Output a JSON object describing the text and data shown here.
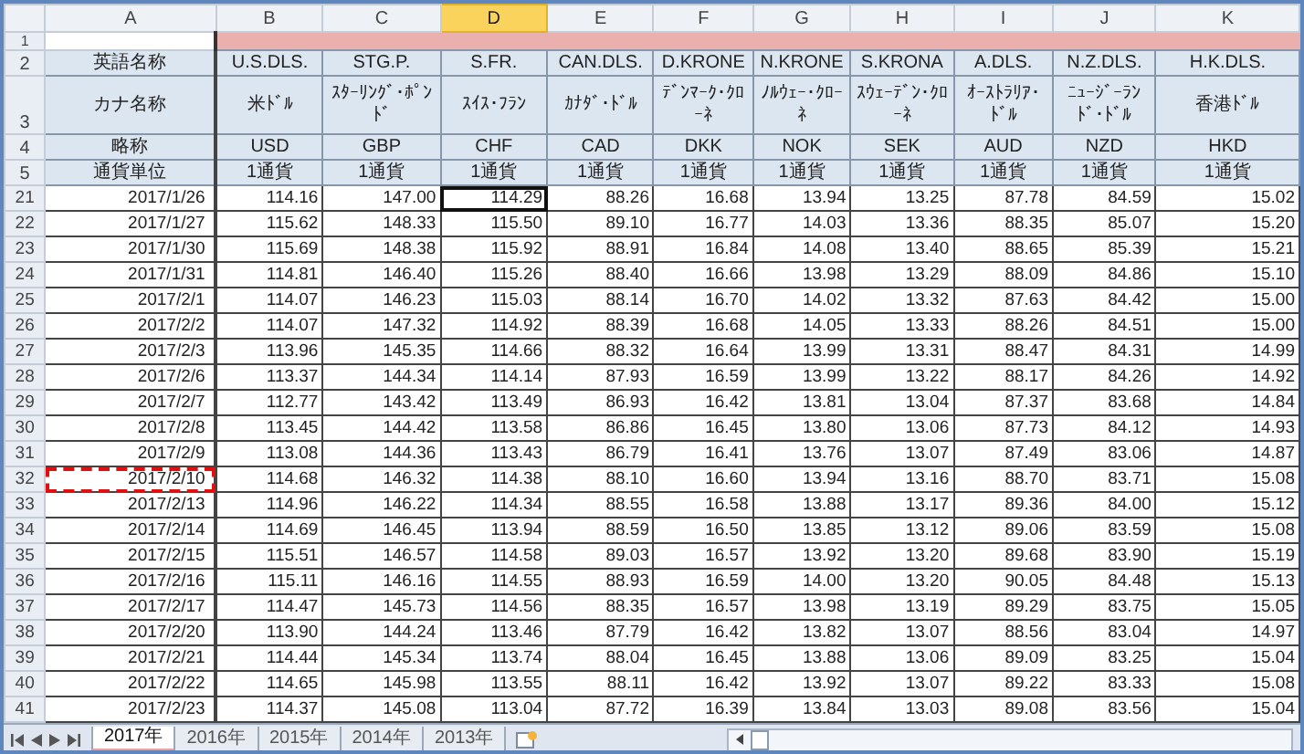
{
  "column_headers": [
    {
      "label": "A",
      "selected": false
    },
    {
      "label": "B",
      "selected": false
    },
    {
      "label": "C",
      "selected": false
    },
    {
      "label": "D",
      "selected": true
    },
    {
      "label": "E",
      "selected": false
    },
    {
      "label": "F",
      "selected": false
    },
    {
      "label": "G",
      "selected": false
    },
    {
      "label": "H",
      "selected": false
    },
    {
      "label": "I",
      "selected": false
    },
    {
      "label": "J",
      "selected": false
    },
    {
      "label": "K",
      "selected": false
    }
  ],
  "header_rows": [
    {
      "number": "1",
      "kind": "banner"
    },
    {
      "number": "2",
      "kind": "text",
      "cells": [
        "英語名称",
        "U.S.DLS.",
        "STG.P.",
        "S.FR.",
        "CAN.DLS.",
        "D.KRONE",
        "N.KRONE",
        "S.KRONA",
        "A.DLS.",
        "N.Z.DLS.",
        "H.K.DLS."
      ]
    },
    {
      "number": "3",
      "kind": "tall",
      "cells": [
        "カナ名称",
        "米ﾄﾞﾙ",
        "ｽﾀｰﾘﾝｸﾞ･ﾎﾟﾝﾄﾞ",
        "ｽｲｽ･ﾌﾗﾝ",
        "ｶﾅﾀﾞ･ﾄﾞﾙ",
        "ﾃﾞﾝﾏｰｸ･ｸﾛｰﾈ",
        "ﾉﾙｳｪｰ･ｸﾛｰﾈ",
        "ｽｳｪｰﾃﾞﾝ･ｸﾛｰﾈ",
        "ｵｰｽﾄﾗﾘｱ･ﾄﾞﾙ",
        "ﾆｭｰｼﾞｰﾗﾝﾄﾞ･ﾄﾞﾙ",
        "香港ﾄﾞﾙ"
      ]
    },
    {
      "number": "4",
      "kind": "text",
      "cells": [
        "略称",
        "USD",
        "GBP",
        "CHF",
        "CAD",
        "DKK",
        "NOK",
        "SEK",
        "AUD",
        "NZD",
        "HKD"
      ]
    },
    {
      "number": "5",
      "kind": "text",
      "cells": [
        "通貨単位",
        "1通貨",
        "1通貨",
        "1通貨",
        "1通貨",
        "1通貨",
        "1通貨",
        "1通貨",
        "1通貨",
        "1通貨",
        "1通貨"
      ]
    }
  ],
  "rows": [
    {
      "number": "21",
      "active": true,
      "marked": false,
      "cells": [
        "2017/1/26",
        "114.16",
        "147.00",
        "114.29",
        "88.26",
        "16.68",
        "13.94",
        "13.25",
        "87.78",
        "84.59",
        "15.02"
      ]
    },
    {
      "number": "22",
      "active": false,
      "marked": false,
      "cells": [
        "2017/1/27",
        "115.62",
        "148.33",
        "115.50",
        "89.10",
        "16.77",
        "14.03",
        "13.36",
        "88.35",
        "85.07",
        "15.20"
      ]
    },
    {
      "number": "23",
      "active": false,
      "marked": false,
      "cells": [
        "2017/1/30",
        "115.69",
        "148.38",
        "115.92",
        "88.91",
        "16.84",
        "14.08",
        "13.40",
        "88.65",
        "85.39",
        "15.21"
      ]
    },
    {
      "number": "24",
      "active": false,
      "marked": false,
      "cells": [
        "2017/1/31",
        "114.81",
        "146.40",
        "115.26",
        "88.40",
        "16.66",
        "13.98",
        "13.29",
        "88.09",
        "84.86",
        "15.10"
      ]
    },
    {
      "number": "25",
      "active": false,
      "marked": false,
      "cells": [
        "2017/2/1",
        "114.07",
        "146.23",
        "115.03",
        "88.14",
        "16.70",
        "14.02",
        "13.32",
        "87.63",
        "84.42",
        "15.00"
      ]
    },
    {
      "number": "26",
      "active": false,
      "marked": false,
      "cells": [
        "2017/2/2",
        "114.07",
        "147.32",
        "114.92",
        "88.39",
        "16.68",
        "14.05",
        "13.33",
        "88.26",
        "84.51",
        "15.00"
      ]
    },
    {
      "number": "27",
      "active": false,
      "marked": false,
      "cells": [
        "2017/2/3",
        "113.96",
        "145.35",
        "114.66",
        "88.32",
        "16.64",
        "13.99",
        "13.31",
        "88.47",
        "84.31",
        "14.99"
      ]
    },
    {
      "number": "28",
      "active": false,
      "marked": false,
      "cells": [
        "2017/2/6",
        "113.37",
        "144.34",
        "114.14",
        "87.93",
        "16.59",
        "13.99",
        "13.22",
        "88.17",
        "84.26",
        "14.92"
      ]
    },
    {
      "number": "29",
      "active": false,
      "marked": false,
      "cells": [
        "2017/2/7",
        "112.77",
        "143.42",
        "113.49",
        "86.93",
        "16.42",
        "13.81",
        "13.04",
        "87.37",
        "83.68",
        "14.84"
      ]
    },
    {
      "number": "30",
      "active": false,
      "marked": false,
      "cells": [
        "2017/2/8",
        "113.45",
        "144.42",
        "113.58",
        "86.86",
        "16.45",
        "13.80",
        "13.06",
        "87.73",
        "84.12",
        "14.93"
      ]
    },
    {
      "number": "31",
      "active": false,
      "marked": false,
      "cells": [
        "2017/2/9",
        "113.08",
        "144.36",
        "113.43",
        "86.79",
        "16.41",
        "13.76",
        "13.07",
        "87.49",
        "83.06",
        "14.87"
      ]
    },
    {
      "number": "32",
      "active": false,
      "marked": true,
      "cells": [
        "2017/2/10",
        "114.68",
        "146.32",
        "114.38",
        "88.10",
        "16.60",
        "13.94",
        "13.16",
        "88.70",
        "83.71",
        "15.08"
      ]
    },
    {
      "number": "33",
      "active": false,
      "marked": false,
      "cells": [
        "2017/2/13",
        "114.96",
        "146.22",
        "114.34",
        "88.55",
        "16.58",
        "13.88",
        "13.17",
        "89.36",
        "84.00",
        "15.12"
      ]
    },
    {
      "number": "34",
      "active": false,
      "marked": false,
      "cells": [
        "2017/2/14",
        "114.69",
        "146.45",
        "113.94",
        "88.59",
        "16.50",
        "13.85",
        "13.12",
        "89.06",
        "83.59",
        "15.08"
      ]
    },
    {
      "number": "35",
      "active": false,
      "marked": false,
      "cells": [
        "2017/2/15",
        "115.51",
        "146.57",
        "114.58",
        "89.03",
        "16.57",
        "13.92",
        "13.20",
        "89.68",
        "83.90",
        "15.19"
      ]
    },
    {
      "number": "36",
      "active": false,
      "marked": false,
      "cells": [
        "2017/2/16",
        "115.11",
        "146.16",
        "114.55",
        "88.93",
        "16.59",
        "14.00",
        "13.20",
        "90.05",
        "84.48",
        "15.13"
      ]
    },
    {
      "number": "37",
      "active": false,
      "marked": false,
      "cells": [
        "2017/2/17",
        "114.47",
        "145.73",
        "114.56",
        "88.35",
        "16.57",
        "13.98",
        "13.19",
        "89.29",
        "83.75",
        "15.05"
      ]
    },
    {
      "number": "38",
      "active": false,
      "marked": false,
      "cells": [
        "2017/2/20",
        "113.90",
        "144.24",
        "113.46",
        "87.79",
        "16.42",
        "13.82",
        "13.07",
        "88.56",
        "83.04",
        "14.97"
      ]
    },
    {
      "number": "39",
      "active": false,
      "marked": false,
      "cells": [
        "2017/2/21",
        "114.44",
        "145.34",
        "113.74",
        "88.04",
        "16.45",
        "13.88",
        "13.06",
        "89.09",
        "83.25",
        "15.04"
      ]
    },
    {
      "number": "40",
      "active": false,
      "marked": false,
      "cells": [
        "2017/2/22",
        "114.65",
        "145.98",
        "113.55",
        "88.11",
        "16.42",
        "13.92",
        "13.07",
        "89.22",
        "83.33",
        "15.08"
      ]
    },
    {
      "number": "41",
      "active": false,
      "marked": false,
      "cells": [
        "2017/2/23",
        "114.37",
        "145.08",
        "113.04",
        "87.72",
        "16.39",
        "13.84",
        "13.03",
        "89.08",
        "83.56",
        "15.04"
      ]
    }
  ],
  "sheet_tabs": [
    {
      "label": "2017年",
      "selected": true
    },
    {
      "label": "2016年",
      "selected": false
    },
    {
      "label": "2015年",
      "selected": false
    },
    {
      "label": "2014年",
      "selected": false
    },
    {
      "label": "2013年",
      "selected": false
    }
  ]
}
